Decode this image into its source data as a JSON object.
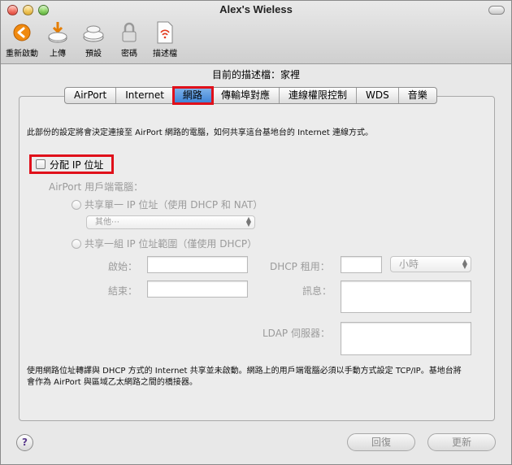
{
  "window": {
    "title": "Alex's Wieless"
  },
  "toolbar": {
    "items": [
      {
        "label": "重新啟動"
      },
      {
        "label": "上傳"
      },
      {
        "label": "預設"
      },
      {
        "label": "密碼"
      },
      {
        "label": "描述檔"
      }
    ]
  },
  "profile": {
    "text": "目前的描述檔：家裡"
  },
  "tabs": [
    {
      "label": "AirPort"
    },
    {
      "label": "Internet"
    },
    {
      "label": "網路",
      "active": true
    },
    {
      "label": "傳輸埠對應"
    },
    {
      "label": "連線權限控制"
    },
    {
      "label": "WDS"
    },
    {
      "label": "音樂"
    }
  ],
  "network": {
    "description": "此部份的設定將會決定連接至 AirPort 網路的電腦，如何共享這台基地台的 Internet 連線方式。",
    "distribute_ip_label": "分配 IP 位址",
    "clients_label": "AirPort 用戶端電腦：",
    "share_single_label": "共享單一 IP 位址（使用 DHCP 和 NAT）",
    "share_single_popup": "其他⋯",
    "share_range_label": "共享一組 IP 位址範圍（僅使用 DHCP）",
    "start_label": "啟始：",
    "end_label": "結束：",
    "lease_label": "DHCP 租用：",
    "lease_unit": "小時",
    "message_label": "訊息：",
    "ldap_label": "LDAP 伺服器：",
    "footnote": "使用網路位址轉譯與 DHCP 方式的 Internet 共享並未啟動。網路上的用戶端電腦必須以手動方式設定 TCP/IP。基地台將會作為 AirPort 與區域乙太網路之間的橋接器。"
  },
  "buttons": {
    "help": "?",
    "revert": "回復",
    "update": "更新"
  },
  "colors": {
    "highlight": "#e0101a",
    "tab_active": "#3d83d6"
  }
}
